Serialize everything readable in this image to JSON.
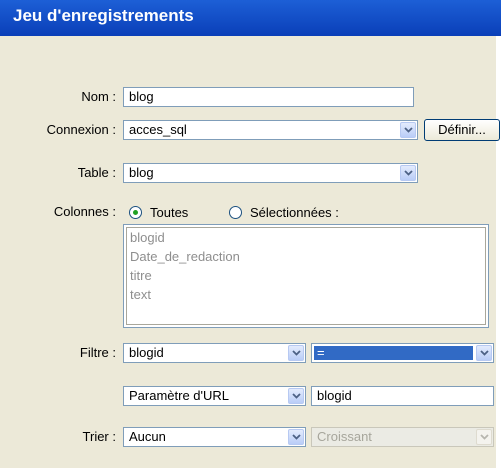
{
  "dialog": {
    "title": "Jeu d'enregistrements"
  },
  "nom": {
    "label": "Nom :",
    "value": "blog"
  },
  "connexion": {
    "label": "Connexion :",
    "value": "acces_sql",
    "define_button": "Définir..."
  },
  "table": {
    "label": "Table :",
    "value": "blog"
  },
  "colonnes": {
    "label": "Colonnes :",
    "option_all": "Toutes",
    "option_selected": "Sélectionnées :",
    "selected_option": "Toutes",
    "items": [
      "blogid",
      "Date_de_redaction",
      "titre",
      "text"
    ]
  },
  "filtre": {
    "label": "Filtre :",
    "column": "blogid",
    "operator": "=",
    "param_type": "Paramètre d'URL",
    "param_value": "blogid"
  },
  "trier": {
    "label": "Trier :",
    "column": "Aucun",
    "order": "Croissant"
  },
  "colors": {
    "title_bar": "#0a46c8",
    "panel": "#ece9d8",
    "field_border": "#7f9db9",
    "selection": "#316ac5"
  }
}
